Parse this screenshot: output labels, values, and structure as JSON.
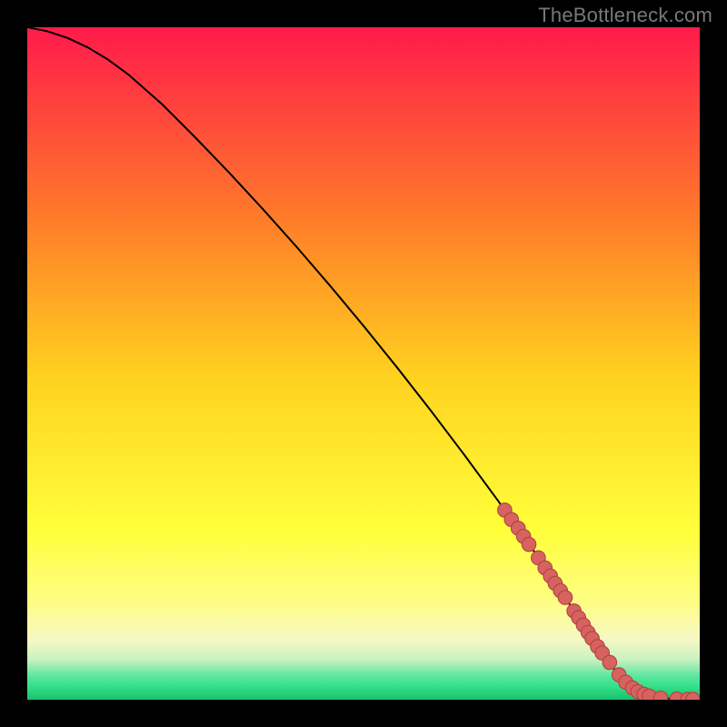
{
  "watermark": "TheBottleneck.com",
  "colors": {
    "grad_top": "#ff1a4b",
    "grad_mid_upper": "#ff7a2a",
    "grad_mid": "#ffd21f",
    "grad_low_yellow": "#ffff66",
    "grad_pale": "#fdfdb0",
    "grad_mint": "#35e08a",
    "curve": "#000000",
    "marker_fill": "#d6635f",
    "marker_stroke": "#b2433f",
    "background": "#000000"
  },
  "chart_data": {
    "type": "line",
    "title": "",
    "xlabel": "",
    "ylabel": "",
    "xlim": [
      0,
      100
    ],
    "ylim": [
      0,
      100
    ],
    "curve": {
      "x": [
        0,
        3,
        6,
        9,
        12,
        15,
        20,
        25,
        30,
        35,
        40,
        45,
        50,
        55,
        60,
        65,
        70,
        75,
        80,
        83,
        86,
        88,
        90,
        92,
        94,
        96,
        98,
        100
      ],
      "y": [
        100,
        99.4,
        98.4,
        97,
        95.2,
        93,
        88.6,
        83.6,
        78.4,
        73,
        67.4,
        61.6,
        55.6,
        49.4,
        43,
        36.4,
        29.6,
        22.6,
        15.2,
        10.6,
        6.2,
        3.6,
        1.8,
        0.8,
        0.3,
        0.1,
        0.05,
        0.05
      ]
    },
    "markers": [
      {
        "x": 71,
        "y": 28.2
      },
      {
        "x": 72,
        "y": 26.8
      },
      {
        "x": 73,
        "y": 25.5
      },
      {
        "x": 73.8,
        "y": 24.3
      },
      {
        "x": 74.6,
        "y": 23.1
      },
      {
        "x": 76,
        "y": 21.1
      },
      {
        "x": 77,
        "y": 19.6
      },
      {
        "x": 77.8,
        "y": 18.4
      },
      {
        "x": 78.5,
        "y": 17.3
      },
      {
        "x": 79.3,
        "y": 16.2
      },
      {
        "x": 80,
        "y": 15.2
      },
      {
        "x": 81.3,
        "y": 13.2
      },
      {
        "x": 82,
        "y": 12.2
      },
      {
        "x": 82.7,
        "y": 11.1
      },
      {
        "x": 83.4,
        "y": 10.0
      },
      {
        "x": 84,
        "y": 9.1
      },
      {
        "x": 84.8,
        "y": 7.9
      },
      {
        "x": 85.5,
        "y": 6.95
      },
      {
        "x": 86.6,
        "y": 5.55
      },
      {
        "x": 88,
        "y": 3.7
      },
      {
        "x": 89,
        "y": 2.6
      },
      {
        "x": 90,
        "y": 1.75
      },
      {
        "x": 90.8,
        "y": 1.2
      },
      {
        "x": 91.7,
        "y": 0.8
      },
      {
        "x": 92.5,
        "y": 0.55
      },
      {
        "x": 94.2,
        "y": 0.25
      },
      {
        "x": 96.6,
        "y": 0.1
      },
      {
        "x": 98.2,
        "y": 0.05
      },
      {
        "x": 99,
        "y": 0.05
      }
    ]
  }
}
